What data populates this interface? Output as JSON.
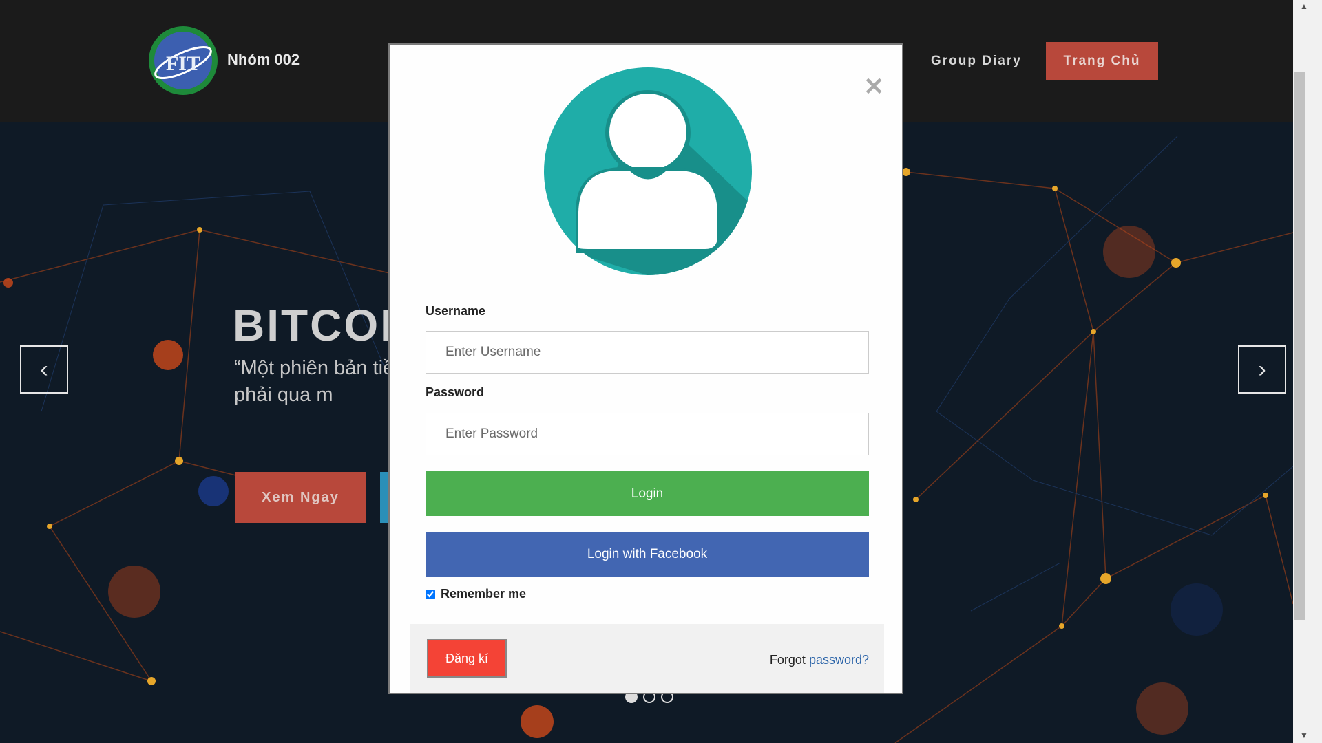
{
  "header": {
    "brand": "Nhóm 002",
    "logo_text": "FIT",
    "nav": {
      "group_diary": "Group Diary",
      "home": "Trang Chủ"
    }
  },
  "hero": {
    "title": "BITCOI",
    "description": "“Một phiên bản tiề phép thanh toán t không phải qua m",
    "cta_label": "Xem Ngay"
  },
  "modal": {
    "username_label": "Username",
    "username_placeholder": "Enter Username",
    "password_label": "Password",
    "password_placeholder": "Enter Password",
    "login_label": "Login",
    "facebook_label": "Login with Facebook",
    "remember_label": "Remember me",
    "remember_checked": true,
    "register_label": "Đăng kí",
    "forgot_text": "Forgot",
    "forgot_link": "password?"
  },
  "icons": {
    "close": "close-icon",
    "avatar": "user-avatar-icon",
    "prev": "chevron-left-icon",
    "next": "chevron-right-icon"
  },
  "colors": {
    "header_bg": "#1b1b1b",
    "accent_red": "#b8483b",
    "login_green": "#4caf50",
    "facebook_blue": "#4266b2",
    "register_red": "#f44336",
    "avatar_teal": "#1fada8"
  }
}
